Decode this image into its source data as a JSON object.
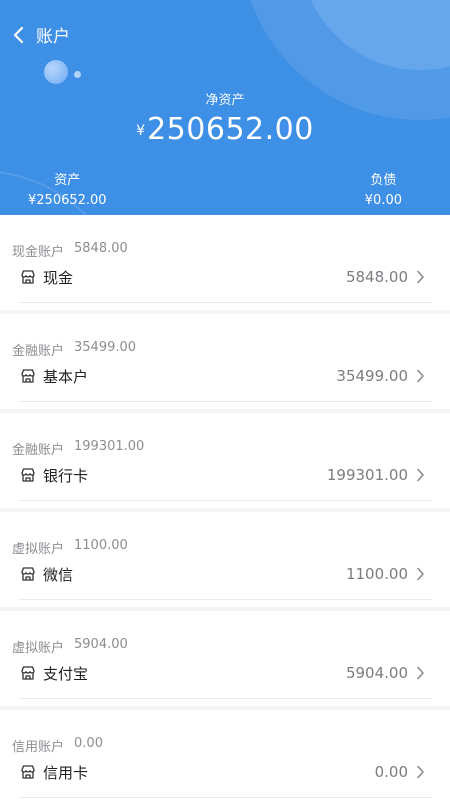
{
  "header": {
    "title": "账户",
    "net_label": "净资产",
    "currency": "¥",
    "net_value": "250652.00",
    "assets_label": "资产",
    "assets_value": "¥250652.00",
    "debts_label": "负债",
    "debts_value": "¥0.00"
  },
  "colors": {
    "header_bg": "#3e8fe6",
    "background": "#f3f4f6"
  },
  "groups": [
    {
      "name": "现金账户",
      "total": "5848.00",
      "item": {
        "label": "现金",
        "amount": "5848.00",
        "icon": "wallet-icon"
      }
    },
    {
      "name": "金融账户",
      "total": "35499.00",
      "item": {
        "label": "基本户",
        "amount": "35499.00",
        "icon": "wallet-icon"
      }
    },
    {
      "name": "金融账户",
      "total": "199301.00",
      "item": {
        "label": "银行卡",
        "amount": "199301.00",
        "icon": "wallet-icon"
      }
    },
    {
      "name": "虚拟账户",
      "total": "1100.00",
      "item": {
        "label": "微信",
        "amount": "1100.00",
        "icon": "wallet-icon"
      }
    },
    {
      "name": "虚拟账户",
      "total": "5904.00",
      "item": {
        "label": "支付宝",
        "amount": "5904.00",
        "icon": "wallet-icon"
      }
    },
    {
      "name": "信用账户",
      "total": "0.00",
      "item": {
        "label": "信用卡",
        "amount": "0.00",
        "icon": "wallet-icon"
      }
    }
  ]
}
